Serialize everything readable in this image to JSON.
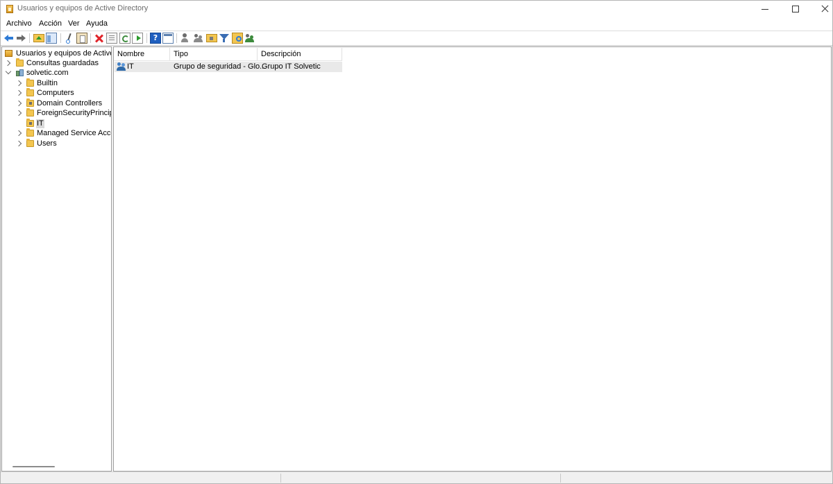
{
  "window": {
    "title": "Usuarios y equipos de Active Directory"
  },
  "menu": {
    "items": [
      {
        "label": "Archivo"
      },
      {
        "label": "Acción"
      },
      {
        "label": "Ver"
      },
      {
        "label": "Ayuda"
      }
    ]
  },
  "toolbar": {
    "icons": [
      "back-icon",
      "forward-icon",
      "up-one-level-icon",
      "show-console-tree-icon",
      "cut-icon",
      "paste-icon",
      "delete-icon",
      "properties-icon",
      "refresh-icon",
      "export-list-icon",
      "help-icon",
      "mmc-window-icon",
      "new-user-icon",
      "new-group-icon",
      "new-ou-icon",
      "filter-icon",
      "find-icon",
      "add-to-group-icon"
    ]
  },
  "tree": {
    "root": {
      "label": "Usuarios y equipos de Active Dir"
    },
    "saved_queries": {
      "label": "Consultas guardadas"
    },
    "domain": {
      "label": "solvetic.com"
    },
    "children": [
      {
        "label": "Builtin"
      },
      {
        "label": "Computers"
      },
      {
        "label": "Domain Controllers"
      },
      {
        "label": "ForeignSecurityPrincipals"
      },
      {
        "label": "IT"
      },
      {
        "label": "Managed Service Accour"
      },
      {
        "label": "Users"
      }
    ]
  },
  "list": {
    "columns": [
      {
        "label": "Nombre"
      },
      {
        "label": "Tipo"
      },
      {
        "label": "Descripción"
      }
    ],
    "rows": [
      {
        "name": "IT",
        "type": "Grupo de seguridad - Glo...",
        "description": "Grupo IT Solvetic"
      }
    ]
  }
}
